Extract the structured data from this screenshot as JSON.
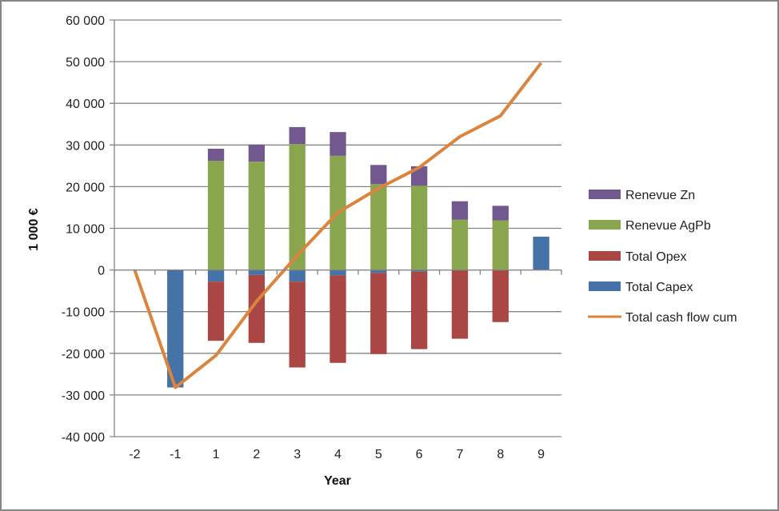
{
  "chart_data": {
    "type": "bar",
    "subtype": "stacked-bar-with-line",
    "title": "",
    "xlabel": "Year",
    "ylabel": "1 000 €",
    "ylim": [
      -40000,
      60000
    ],
    "yticks": [
      60000,
      50000,
      40000,
      30000,
      20000,
      10000,
      0,
      -10000,
      -20000,
      -30000,
      -40000
    ],
    "ytick_labels": [
      "60 000",
      "50 000",
      "40 000",
      "30 000",
      "20 000",
      "10 000",
      "0",
      "-10 000",
      "-20 000",
      "-30 000",
      "-40 000"
    ],
    "grid": true,
    "legend_position": "right",
    "categories": [
      "-2",
      "-1",
      "1",
      "2",
      "3",
      "4",
      "5",
      "6",
      "7",
      "8",
      "9"
    ],
    "series": [
      {
        "name": "Renevue Zn",
        "kind": "bar",
        "color": "#71588f",
        "values": [
          0,
          0,
          2900,
          4100,
          4100,
          5700,
          4600,
          4700,
          4400,
          3500,
          0
        ]
      },
      {
        "name": "Renevue AgPb",
        "kind": "bar",
        "color": "#89a54e",
        "values": [
          0,
          0,
          26200,
          26000,
          30200,
          27400,
          20600,
          20200,
          12100,
          11900,
          0
        ]
      },
      {
        "name": "Total Opex",
        "kind": "bar",
        "color": "#aa4643",
        "values": [
          0,
          0,
          -14200,
          -16300,
          -20600,
          -21000,
          -19500,
          -18600,
          -16500,
          -12500,
          0
        ]
      },
      {
        "name": "Total Capex",
        "kind": "bar",
        "color": "#4572a7",
        "values": [
          0,
          -28200,
          -2800,
          -1200,
          -2800,
          -1300,
          -700,
          -400,
          0,
          0,
          8000
        ]
      },
      {
        "name": "Total cash flow cum",
        "kind": "line",
        "color": "#db843d",
        "values": [
          0,
          -28200,
          -20500,
          -7500,
          3500,
          13800,
          19600,
          24600,
          32000,
          37000,
          49700
        ]
      }
    ]
  }
}
